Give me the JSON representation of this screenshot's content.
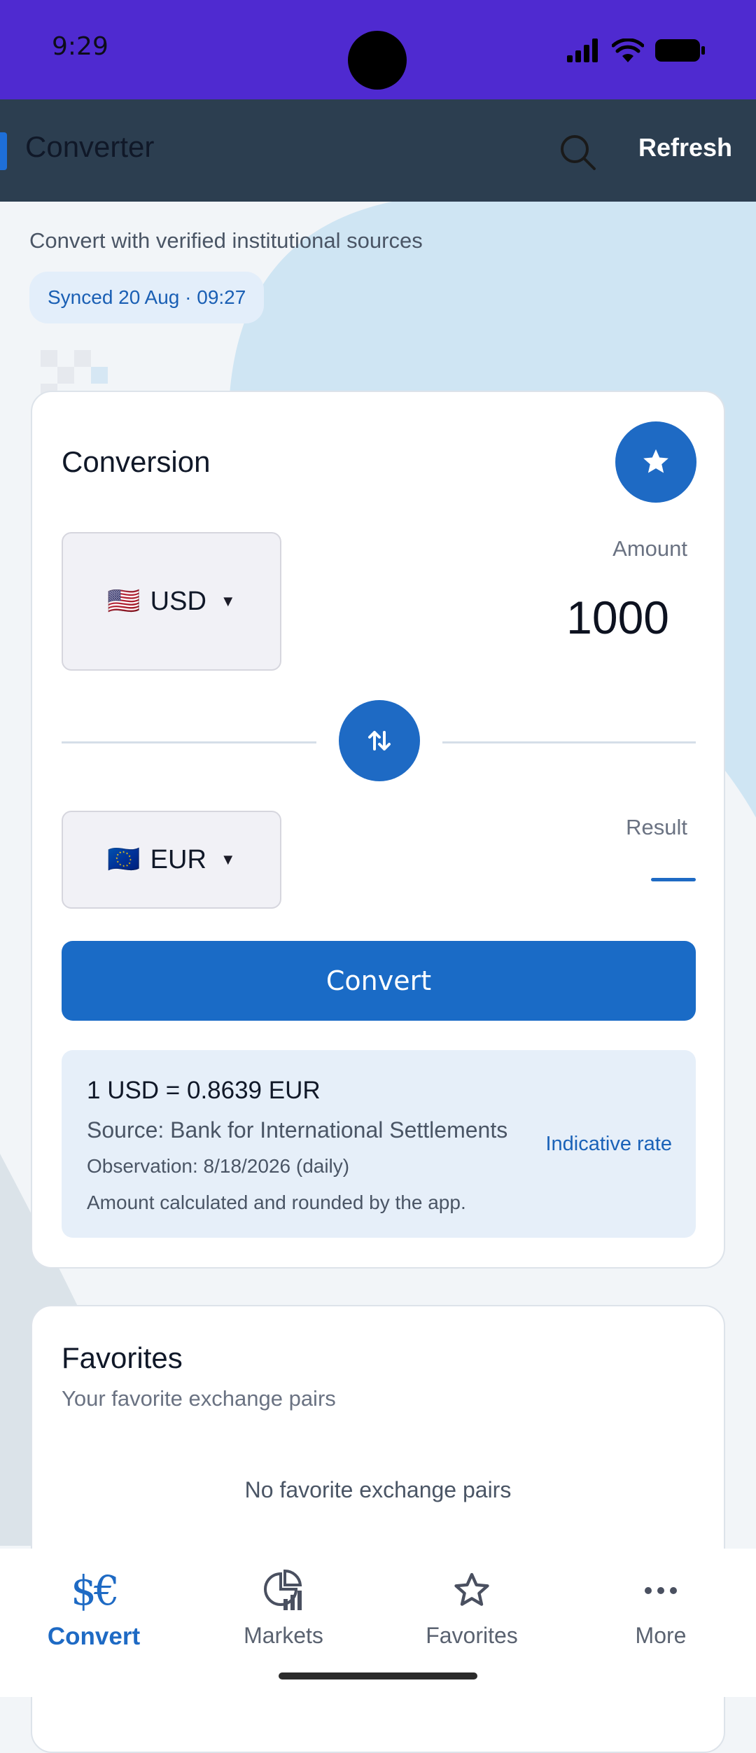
{
  "status_bar": {
    "time": "9:29"
  },
  "app_bar": {
    "title": "Converter",
    "refresh_label": "Refresh"
  },
  "header": {
    "subtitle": "Convert with verified institutional sources",
    "sync_badge": "Synced 20 Aug · 09:27"
  },
  "conversion": {
    "title": "Conversion",
    "from_currency": {
      "flag": "🇺🇸",
      "code": "USD"
    },
    "amount_label": "Amount",
    "amount_value": "1000",
    "to_currency": {
      "flag": "🇪🇺",
      "code": "EUR"
    },
    "result_label": "Result",
    "convert_label": "Convert",
    "rate": {
      "main": "1 USD = 0.8639 EUR",
      "source": "Source: Bank for International Settlements",
      "observation": "Observation: 8/18/2026 (daily)",
      "note": "Amount calculated and rounded by the app.",
      "badge": "Indicative rate"
    }
  },
  "favorites": {
    "title": "Favorites",
    "subtitle": "Your favorite exchange pairs",
    "empty_text": "No favorite exchange pairs"
  },
  "bottom_nav": {
    "items": [
      {
        "label": "Convert",
        "icon": "currency-exchange-icon",
        "active": true
      },
      {
        "label": "Markets",
        "icon": "markets-chart-icon",
        "active": false
      },
      {
        "label": "Favorites",
        "icon": "star-icon",
        "active": false
      },
      {
        "label": "More",
        "icon": "more-dots-icon",
        "active": false
      }
    ]
  },
  "colors": {
    "status_bar": "#4f2ad0",
    "app_bar": "#2c3e50",
    "primary": "#1e6ac4",
    "rate_box": "#e6eff9"
  }
}
